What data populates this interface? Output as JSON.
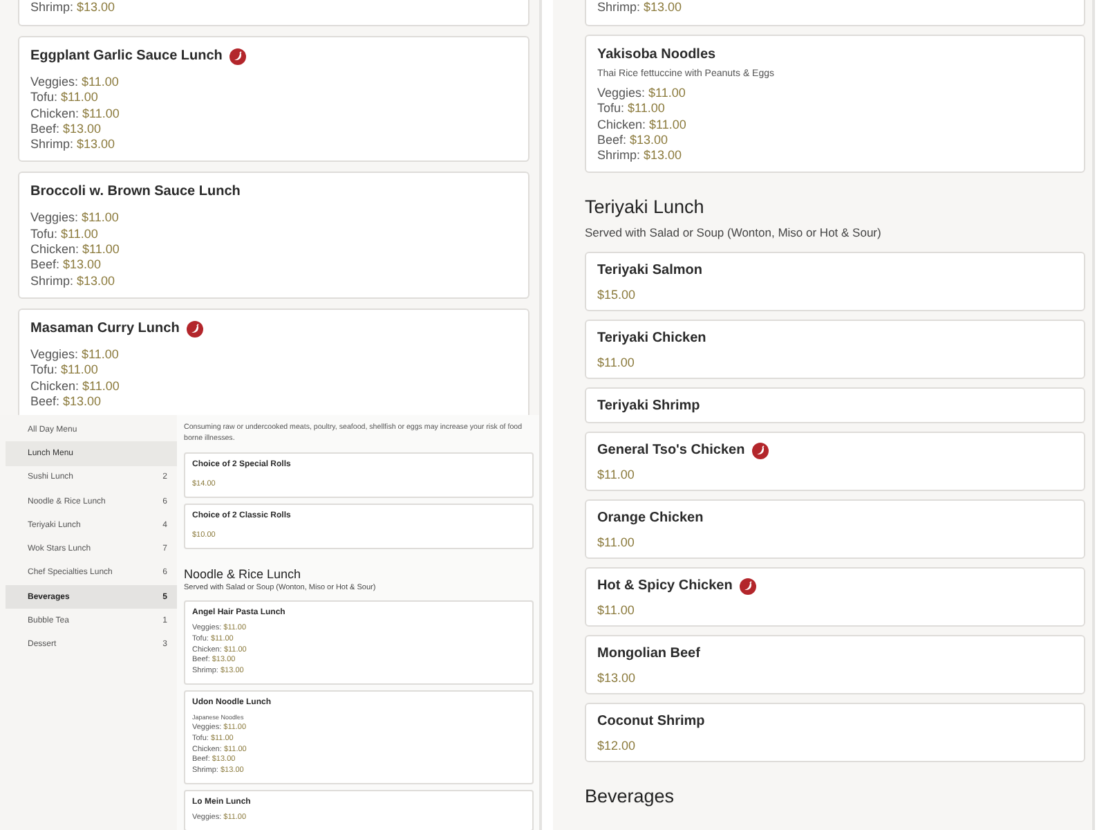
{
  "panels": [
    {
      "kind": "list",
      "blocks": [
        {
          "kind": "card_fragment",
          "prices": [
            {
              "label": "Shrimp:",
              "price": "$13.00"
            }
          ]
        },
        {
          "kind": "card",
          "title": "Eggplant Garlic Sauce Lunch",
          "spicy": true,
          "prices": [
            {
              "label": "Veggies:",
              "price": "$11.00"
            },
            {
              "label": "Tofu:",
              "price": "$11.00"
            },
            {
              "label": "Chicken:",
              "price": "$11.00"
            },
            {
              "label": "Beef:",
              "price": "$13.00"
            },
            {
              "label": "Shrimp:",
              "price": "$13.00"
            }
          ]
        },
        {
          "kind": "card",
          "title": "Broccoli w. Brown Sauce Lunch",
          "spicy": false,
          "prices": [
            {
              "label": "Veggies:",
              "price": "$11.00"
            },
            {
              "label": "Tofu:",
              "price": "$11.00"
            },
            {
              "label": "Chicken:",
              "price": "$11.00"
            },
            {
              "label": "Beef:",
              "price": "$13.00"
            },
            {
              "label": "Shrimp:",
              "price": "$13.00"
            }
          ]
        },
        {
          "kind": "card",
          "title": "Masaman Curry Lunch",
          "spicy": true,
          "prices": [
            {
              "label": "Veggies:",
              "price": "$11.00"
            },
            {
              "label": "Tofu:",
              "price": "$11.00"
            },
            {
              "label": "Chicken:",
              "price": "$11.00"
            },
            {
              "label": "Beef:",
              "price": "$13.00"
            }
          ]
        }
      ]
    },
    {
      "kind": "list",
      "blocks": [
        {
          "kind": "card_fragment",
          "prices": [
            {
              "label": "Shrimp:",
              "price": "$13.00"
            }
          ]
        },
        {
          "kind": "card",
          "title": "Yakisoba Noodles",
          "spicy": false,
          "description": "Thai Rice fettuccine with Peanuts & Eggs",
          "prices": [
            {
              "label": "Veggies:",
              "price": "$11.00"
            },
            {
              "label": "Tofu:",
              "price": "$11.00"
            },
            {
              "label": "Chicken:",
              "price": "$11.00"
            },
            {
              "label": "Beef:",
              "price": "$13.00"
            },
            {
              "label": "Shrimp:",
              "price": "$13.00"
            }
          ]
        },
        {
          "kind": "heading",
          "title": "Teriyaki Lunch",
          "subtitle": "Served with Salad or Soup (Wonton, Miso or Hot & Sour)"
        },
        {
          "kind": "card",
          "title": "Teriyaki Salmon",
          "spicy": false,
          "price": "$15.00"
        },
        {
          "kind": "card",
          "title": "Teriyaki Chicken",
          "spicy": false,
          "price": "$11.00"
        },
        {
          "kind": "card",
          "title": "Teriyaki Shrimp",
          "spicy": false
        }
      ]
    },
    {
      "kind": "menu",
      "sidebar": [
        {
          "kind": "menu",
          "label": "All Day Menu",
          "selected": false
        },
        {
          "kind": "menu",
          "label": "Lunch Menu",
          "selected": true
        },
        {
          "kind": "category",
          "label": "Sushi Lunch",
          "count": "2",
          "selected": false
        },
        {
          "kind": "category",
          "label": "Noodle & Rice Lunch",
          "count": "6",
          "selected": false
        },
        {
          "kind": "category",
          "label": "Teriyaki Lunch",
          "count": "4",
          "selected": false
        },
        {
          "kind": "category",
          "label": "Wok Stars Lunch",
          "count": "7",
          "selected": false
        },
        {
          "kind": "category",
          "label": "Chef Specialties Lunch",
          "count": "6",
          "selected": false
        },
        {
          "kind": "category",
          "label": "Beverages",
          "count": "5",
          "selected": true
        },
        {
          "kind": "category",
          "label": "Bubble Tea",
          "count": "1",
          "selected": false
        },
        {
          "kind": "category",
          "label": "Dessert",
          "count": "3",
          "selected": false
        }
      ],
      "blocks": [
        {
          "kind": "notice",
          "text": "Consuming raw or undercooked meats, poultry, seafood, shellfish or eggs may increase your risk of food borne illnesses."
        },
        {
          "kind": "card",
          "title": "Choice of 2 Special Rolls",
          "spicy": false,
          "price": "$14.00"
        },
        {
          "kind": "card",
          "title": "Choice of 2 Classic Rolls",
          "spicy": false,
          "price": "$10.00"
        },
        {
          "kind": "heading",
          "title": "Noodle & Rice Lunch",
          "subtitle": "Served with Salad or Soup (Wonton, Miso or Hot & Sour)"
        },
        {
          "kind": "card",
          "title": "Angel Hair Pasta Lunch",
          "spicy": false,
          "prices": [
            {
              "label": "Veggies:",
              "price": "$11.00"
            },
            {
              "label": "Tofu:",
              "price": "$11.00"
            },
            {
              "label": "Chicken:",
              "price": "$11.00"
            },
            {
              "label": "Beef:",
              "price": "$13.00"
            },
            {
              "label": "Shrimp:",
              "price": "$13.00"
            }
          ]
        },
        {
          "kind": "card",
          "title": "Udon Noodle Lunch",
          "spicy": false,
          "description": "Japanese Noodles",
          "prices": [
            {
              "label": "Veggies:",
              "price": "$11.00"
            },
            {
              "label": "Tofu:",
              "price": "$11.00"
            },
            {
              "label": "Chicken:",
              "price": "$11.00"
            },
            {
              "label": "Beef:",
              "price": "$13.00"
            },
            {
              "label": "Shrimp:",
              "price": "$13.00"
            }
          ]
        },
        {
          "kind": "card",
          "title": "Lo Mein Lunch",
          "spicy": false,
          "prices": [
            {
              "label": "Veggies:",
              "price": "$11.00"
            }
          ]
        }
      ]
    },
    {
      "kind": "list",
      "blocks": [
        {
          "kind": "card_fragment"
        },
        {
          "kind": "card",
          "title": "General Tso's Chicken",
          "spicy": true,
          "price": "$11.00"
        },
        {
          "kind": "card",
          "title": "Orange Chicken",
          "spicy": false,
          "price": "$11.00"
        },
        {
          "kind": "card",
          "title": "Hot & Spicy Chicken",
          "spicy": true,
          "price": "$11.00"
        },
        {
          "kind": "card",
          "title": "Mongolian Beef",
          "spicy": false,
          "price": "$13.00"
        },
        {
          "kind": "card",
          "title": "Coconut Shrimp",
          "spicy": false,
          "price": "$12.00"
        },
        {
          "kind": "heading",
          "title": "Beverages"
        }
      ]
    }
  ]
}
